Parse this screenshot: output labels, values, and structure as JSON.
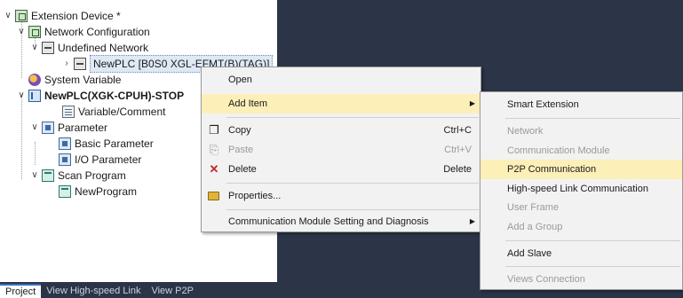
{
  "tree": {
    "extension_device": "Extension Device *",
    "network_configuration": "Network Configuration",
    "undefined_network": "Undefined Network",
    "newplc_network_item": "NewPLC [B0S0 XGL-EFMT(B)(TAG)]",
    "system_variable": "System Variable",
    "newplc_project": "NewPLC(XGK-CPUH)-STOP",
    "variable_comment": "Variable/Comment",
    "parameter": "Parameter",
    "basic_parameter": "Basic Parameter",
    "io_parameter": "I/O Parameter",
    "scan_program": "Scan Program",
    "new_program": "NewProgram"
  },
  "tabs": [
    {
      "label": "Project"
    },
    {
      "label": "View High-speed Link"
    },
    {
      "label": "View P2P"
    }
  ],
  "context_menu": {
    "open": "Open",
    "add_item": "Add Item",
    "copy": "Copy",
    "copy_shortcut": "Ctrl+C",
    "paste": "Paste",
    "paste_shortcut": "Ctrl+V",
    "delete": "Delete",
    "delete_shortcut": "Delete",
    "properties": "Properties...",
    "comm_module_setting": "Communication Module Setting and Diagnosis"
  },
  "submenu": {
    "smart_extension": "Smart Extension",
    "network": "Network",
    "communication_module": "Communication Module",
    "p2p_communication": "P2P Communication",
    "high_speed_link": "High-speed Link Communication",
    "user_frame": "User Frame",
    "add_group": "Add a Group",
    "add_slave": "Add Slave",
    "views_connection": "Views Connection"
  },
  "icons": {
    "copy": "copy-icon",
    "paste": "paste-icon",
    "delete": "delete-icon",
    "properties": "properties-icon",
    "submenu_arrow": "chevron-right-icon"
  },
  "colors": {
    "workspace": "#2b3547",
    "highlight": "#fcefb8",
    "delete_icon": "#c0282a"
  }
}
